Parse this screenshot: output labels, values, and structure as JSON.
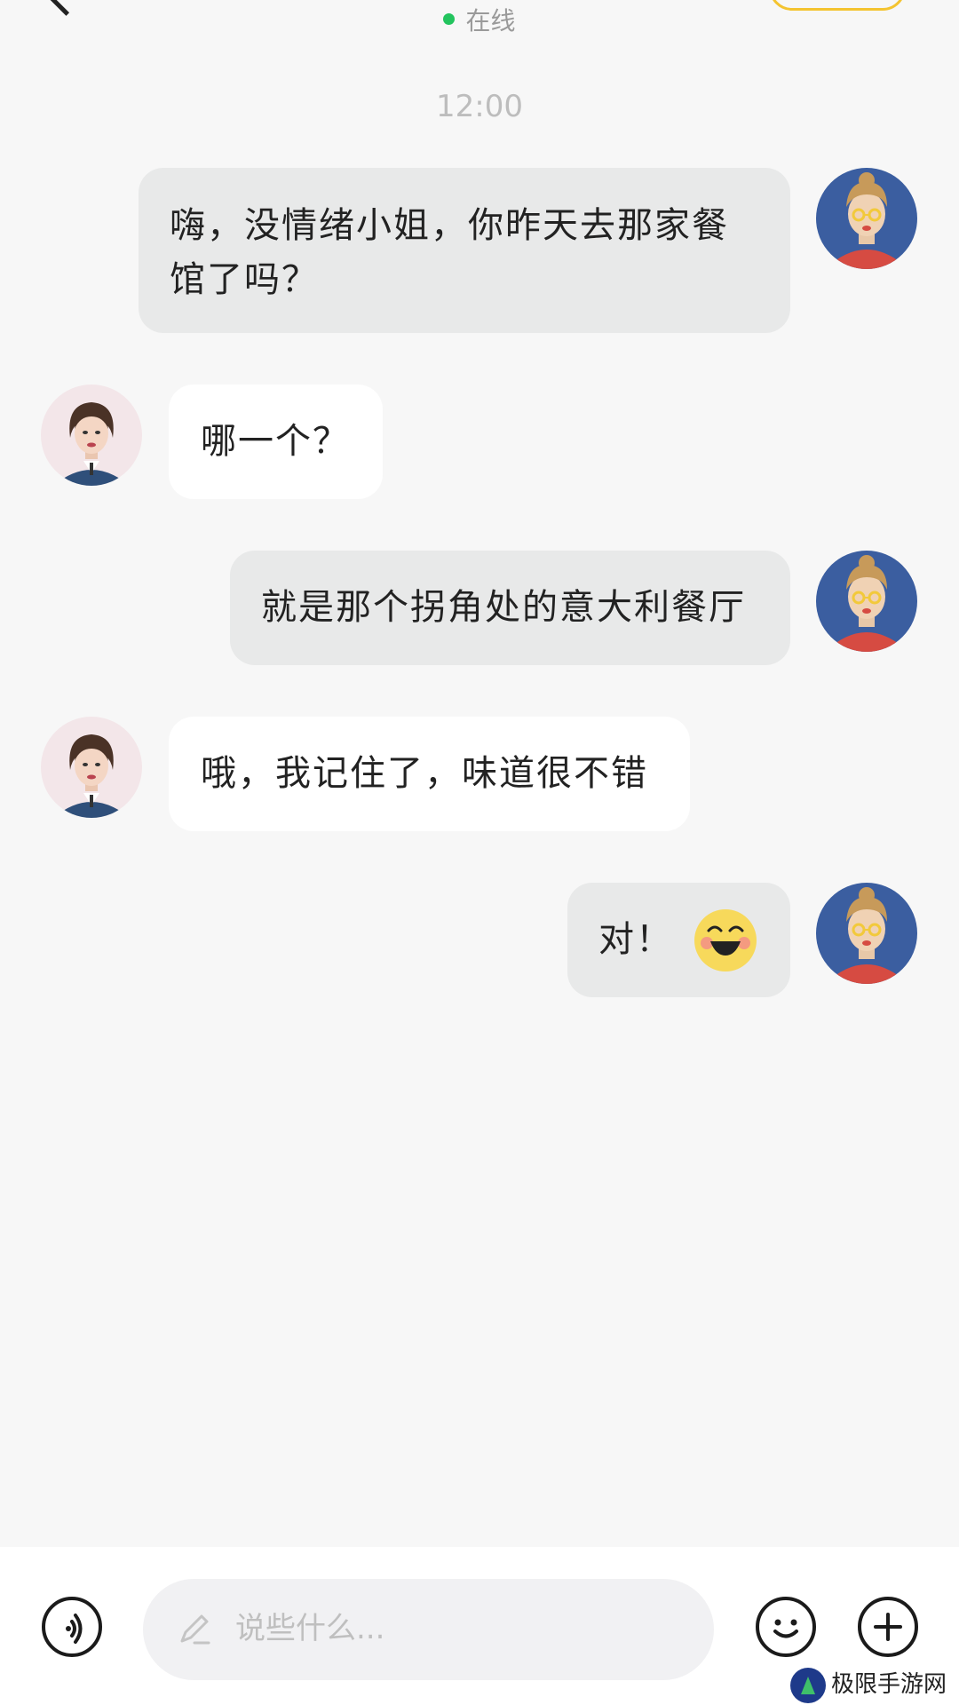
{
  "header": {
    "status": "在线",
    "status_color": "#23c45e"
  },
  "chat": {
    "timestamp": "12:00",
    "messages": [
      {
        "side": "out",
        "text": "嗨，没情绪小姐，你昨天去那家餐馆了吗？"
      },
      {
        "side": "in",
        "text": "哪一个？"
      },
      {
        "side": "out",
        "text": "就是那个拐角处的意大利餐厅"
      },
      {
        "side": "in",
        "text": "哦，我记住了，味道很不错"
      },
      {
        "side": "out",
        "text": "对！",
        "emoji": "laughing-face-emoji"
      }
    ]
  },
  "input_bar": {
    "placeholder": "说些什么...",
    "voice_icon": "voice-icon",
    "emoji_icon": "smile-icon",
    "add_icon": "plus-icon"
  },
  "watermark": {
    "text": "极限手游网"
  },
  "colors": {
    "background": "#f7f7f7",
    "outgoing_bubble": "#e8e9e9",
    "incoming_bubble": "#ffffff",
    "accent": "#f4c430"
  }
}
